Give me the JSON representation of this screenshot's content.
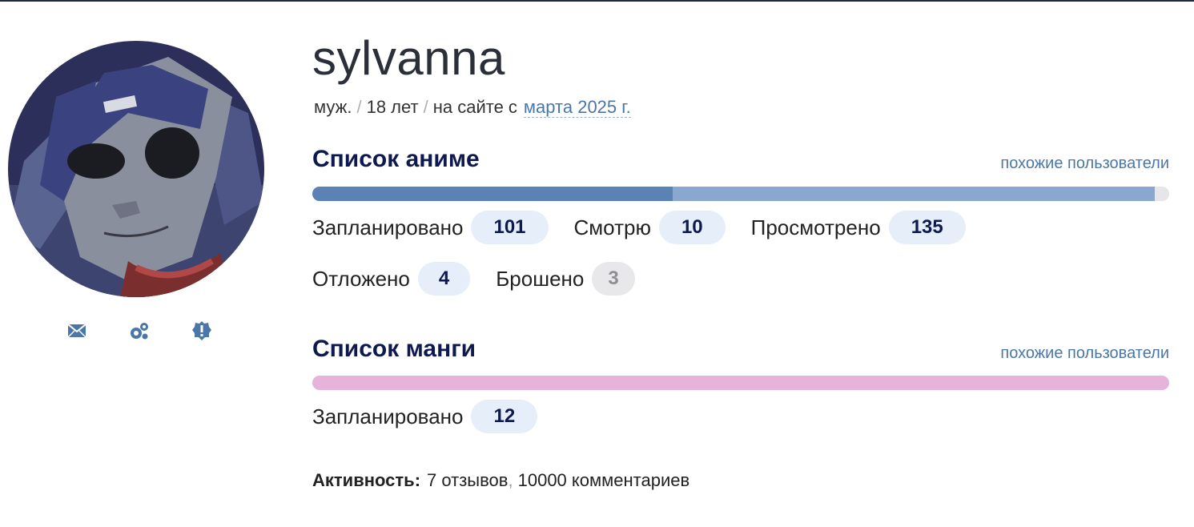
{
  "profile": {
    "username": "sylvanna",
    "gender": "муж.",
    "separator": "/",
    "age": "18 лет",
    "on_site_label": "на сайте с",
    "joined": "марта 2025 г."
  },
  "actions": {
    "icons": [
      "envelope-icon",
      "gears-icon",
      "badge-alert-icon"
    ]
  },
  "anime": {
    "title": "Список аниме",
    "similar": "похожие пользователи",
    "bar": [
      {
        "name": "planned",
        "value": 101,
        "color": "#5b82b5"
      },
      {
        "name": "watched",
        "value": 135,
        "color": "#8aa7cf"
      },
      {
        "name": "rest",
        "value": 4,
        "color": "#e6e6ea"
      }
    ],
    "stats": [
      {
        "label": "Запланировано",
        "value": "101"
      },
      {
        "label": "Смотрю",
        "value": "10"
      },
      {
        "label": "Просмотрено",
        "value": "135"
      },
      {
        "label": "Отложено",
        "value": "4"
      },
      {
        "label": "Брошено",
        "value": "3"
      }
    ]
  },
  "manga": {
    "title": "Список манги",
    "similar": "похожие пользователи",
    "bar_color": "#e6b3da",
    "stats": [
      {
        "label": "Запланировано",
        "value": "12"
      }
    ]
  },
  "activity": {
    "label": "Активность:",
    "reviews": "7 отзывов",
    "comma": ",",
    "comments": "10000 комментариев"
  }
}
